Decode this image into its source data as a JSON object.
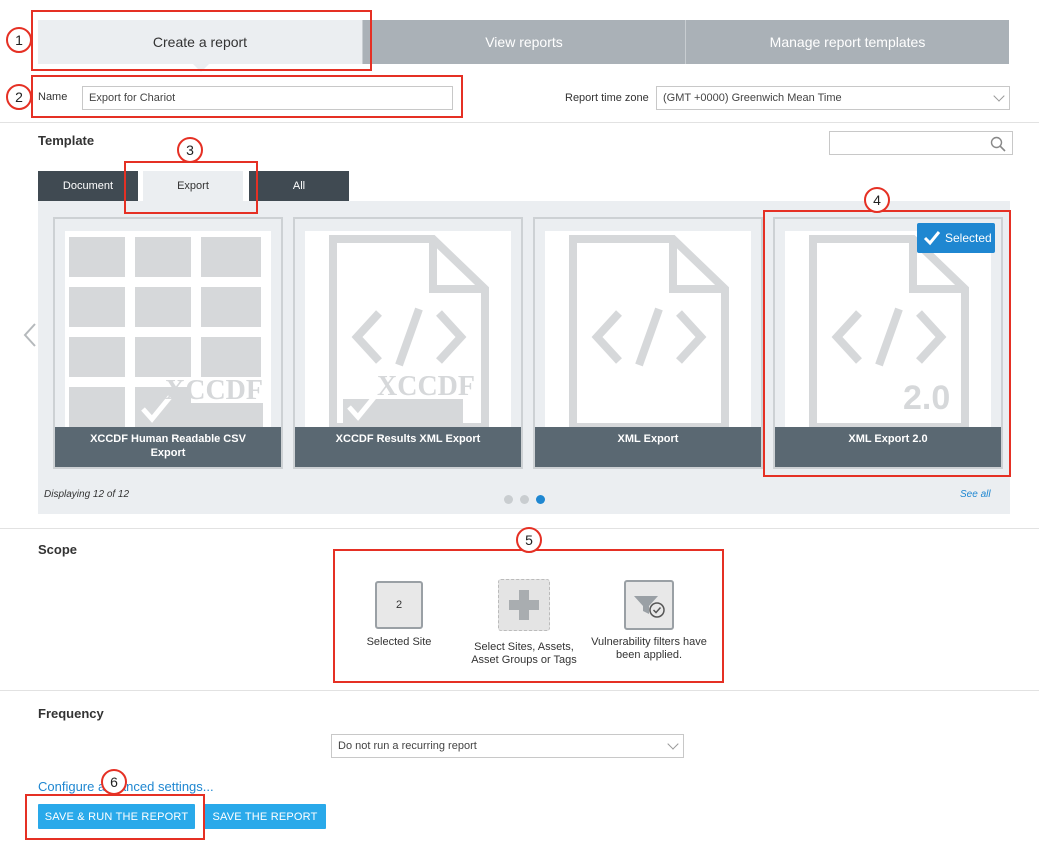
{
  "tabs": [
    "Create a report",
    "View reports",
    "Manage report templates"
  ],
  "name_label": "Name",
  "name_value": "Export for Chariot",
  "timezone_label": "Report time zone",
  "timezone_value": "(GMT +0000) Greenwich Mean Time",
  "template": {
    "title": "Template",
    "search_placeholder": "",
    "tabs": [
      "Document",
      "Export",
      "All"
    ],
    "cards": [
      {
        "caption": "XCCDF Human Readable CSV Export",
        "watermark": "XCCDF"
      },
      {
        "caption": "XCCDF Results XML Export",
        "watermark": "XCCDF"
      },
      {
        "caption": "XML Export",
        "watermark": ""
      },
      {
        "caption": "XML Export 2.0",
        "watermark": "2.0"
      }
    ],
    "selected_label": "Selected",
    "displaying": "Displaying 12 of 12",
    "see_all": "See all"
  },
  "scope": {
    "title": "Scope",
    "selected_count": "2",
    "selected_label": "Selected Site",
    "add_label": "Select Sites, Assets, Asset Groups or Tags",
    "filter_label": "Vulnerability filters have been applied."
  },
  "frequency": {
    "title": "Frequency",
    "value": "Do not run a recurring report"
  },
  "configure_link": "Configure advanced settings...",
  "buttons": {
    "save_run": "SAVE & RUN THE REPORT",
    "save": "SAVE THE REPORT"
  },
  "annotations": [
    "1",
    "2",
    "3",
    "4",
    "5",
    "6"
  ],
  "colors": {
    "accent": "#1f87d1",
    "button": "#29a9ea",
    "annotation": "#e53024",
    "dark_tab": "#404a52"
  }
}
